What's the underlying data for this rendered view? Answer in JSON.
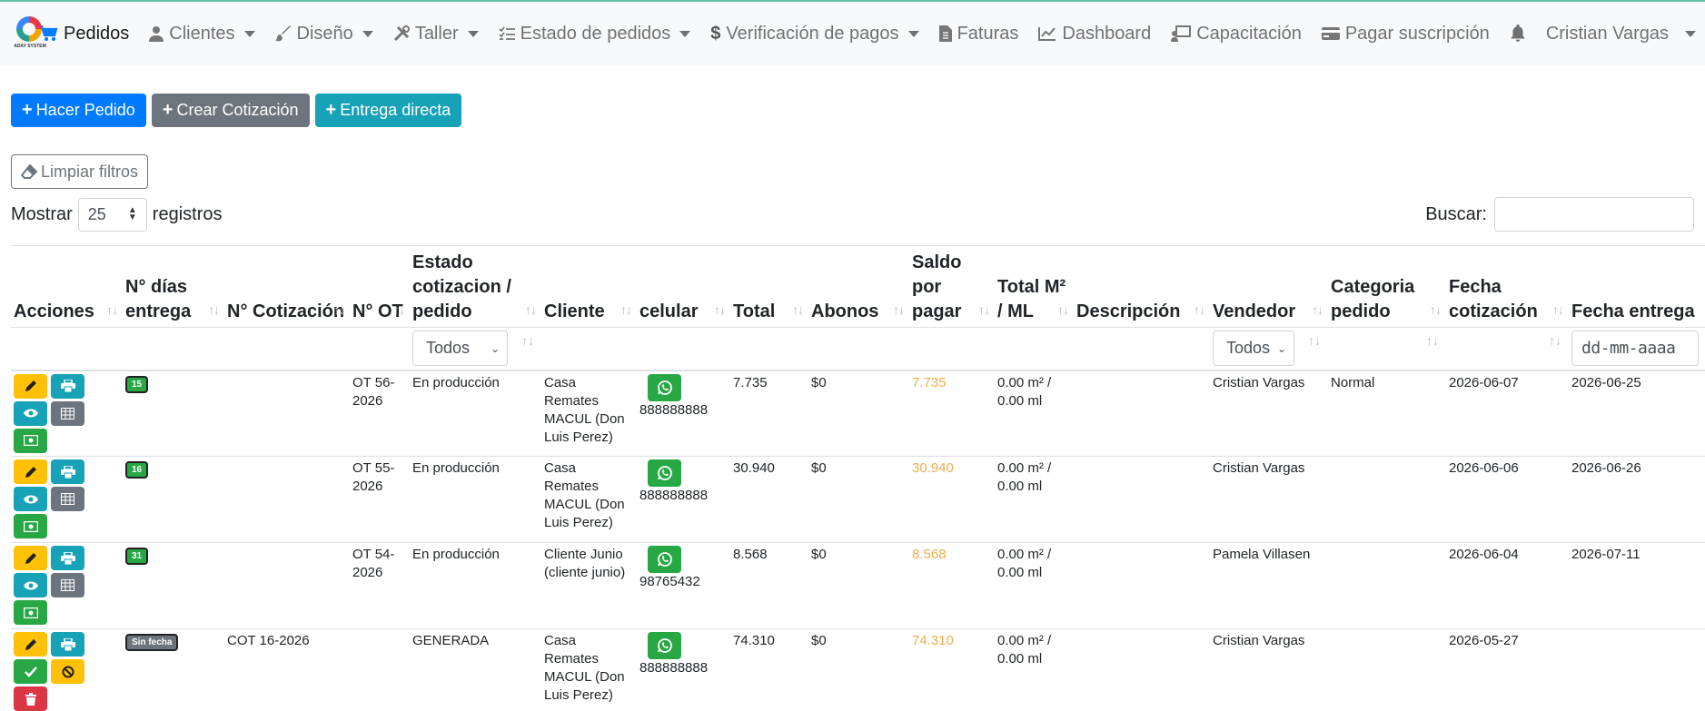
{
  "nav": {
    "logo_text": "ADAY SYSTEM",
    "items": [
      {
        "label": "Pedidos",
        "icon": "cart-icon",
        "active": true,
        "dropdown": false
      },
      {
        "label": "Clientes",
        "icon": "user-icon",
        "active": false,
        "dropdown": true
      },
      {
        "label": "Diseño",
        "icon": "brush-icon",
        "active": false,
        "dropdown": true
      },
      {
        "label": "Taller",
        "icon": "tools-icon",
        "active": false,
        "dropdown": true
      },
      {
        "label": "Estado de pedidos",
        "icon": "checklist-icon",
        "active": false,
        "dropdown": true
      },
      {
        "label": "Verificación de pagos",
        "icon": "dollar-icon",
        "active": false,
        "dropdown": true
      },
      {
        "label": "Faturas",
        "icon": "invoice-icon",
        "active": false,
        "dropdown": false
      },
      {
        "label": "Dashboard",
        "icon": "chart-line-icon",
        "active": false,
        "dropdown": false
      },
      {
        "label": "Capacitación",
        "icon": "training-icon",
        "active": false,
        "dropdown": false
      },
      {
        "label": "Pagar suscripción",
        "icon": "credit-card-icon",
        "active": false,
        "dropdown": false
      }
    ],
    "user": "Cristian Vargas"
  },
  "buttons": {
    "hacer_pedido": "Hacer Pedido",
    "crear_cotizacion": "Crear Cotización",
    "entrega_directa": "Entrega directa",
    "limpiar_filtros": "Limpiar filtros"
  },
  "length": {
    "prefix": "Mostrar",
    "value": "25",
    "suffix": "registros"
  },
  "search": {
    "label": "Buscar:"
  },
  "columns": [
    "Acciones",
    "N° días entrega",
    "N° Cotización",
    "N° OT",
    "Estado cotizacion / pedido",
    "Cliente",
    "celular",
    "Total",
    "Abonos",
    "Saldo por pagar",
    "Total M² / ML",
    "Descripción",
    "Vendedor",
    "Categoria pedido",
    "Fecha cotización",
    "Fecha entrega"
  ],
  "filters": {
    "estado": "Todos",
    "vendedor": "Todos",
    "fecha_entrega_placeholder": "dd-mm-aaaa"
  },
  "rows": [
    {
      "dias": "15",
      "cotizacion": "",
      "ot": "OT 56-2026",
      "estado": "En producción",
      "cliente": "Casa Remates MACUL (Don Luis Perez)",
      "celular": "888888888",
      "total": "7.735",
      "abonos": "$0",
      "saldo": "7.735",
      "m2": "0.00 m² / 0.00 ml",
      "descripcion": "",
      "vendedor": "Cristian Vargas",
      "categoria": "Normal",
      "fecha_cot": "2026-06-07",
      "fecha_ent": "2026-06-25",
      "kind": "pedido"
    },
    {
      "dias": "16",
      "cotizacion": "",
      "ot": "OT 55-2026",
      "estado": "En producción",
      "cliente": "Casa Remates MACUL (Don Luis Perez)",
      "celular": "888888888",
      "total": "30.940",
      "abonos": "$0",
      "saldo": "30.940",
      "m2": "0.00 m² / 0.00 ml",
      "descripcion": "",
      "vendedor": "Cristian Vargas",
      "categoria": "",
      "fecha_cot": "2026-06-06",
      "fecha_ent": "2026-06-26",
      "kind": "pedido"
    },
    {
      "dias": "31",
      "cotizacion": "",
      "ot": "OT 54-2026",
      "estado": "En producción",
      "cliente": "Cliente Junio (cliente junio)",
      "celular": "98765432",
      "total": "8.568",
      "abonos": "$0",
      "saldo": "8.568",
      "m2": "0.00 m² / 0.00 ml",
      "descripcion": "",
      "vendedor": "Pamela Villasen",
      "categoria": "",
      "fecha_cot": "2026-06-04",
      "fecha_ent": "2026-07-11",
      "kind": "pedido"
    },
    {
      "dias": "Sin fecha",
      "cotizacion": "COT 16-2026",
      "ot": "",
      "estado": "GENERADA",
      "cliente": "Casa Remates MACUL (Don Luis Perez)",
      "celular": "888888888",
      "total": "74.310",
      "abonos": "$0",
      "saldo": "74.310",
      "m2": "0.00 m² / 0.00 ml",
      "descripcion": "",
      "vendedor": "Cristian Vargas",
      "categoria": "",
      "fecha_cot": "2026-05-27",
      "fecha_ent": "",
      "kind": "cotizacion"
    }
  ],
  "colors": {
    "primary": "#007bff",
    "secondary": "#6c757d",
    "info": "#17a2b8",
    "success": "#28a745",
    "warning": "#ffc107",
    "danger": "#dc3545",
    "saldo": "#f0ad4e"
  }
}
